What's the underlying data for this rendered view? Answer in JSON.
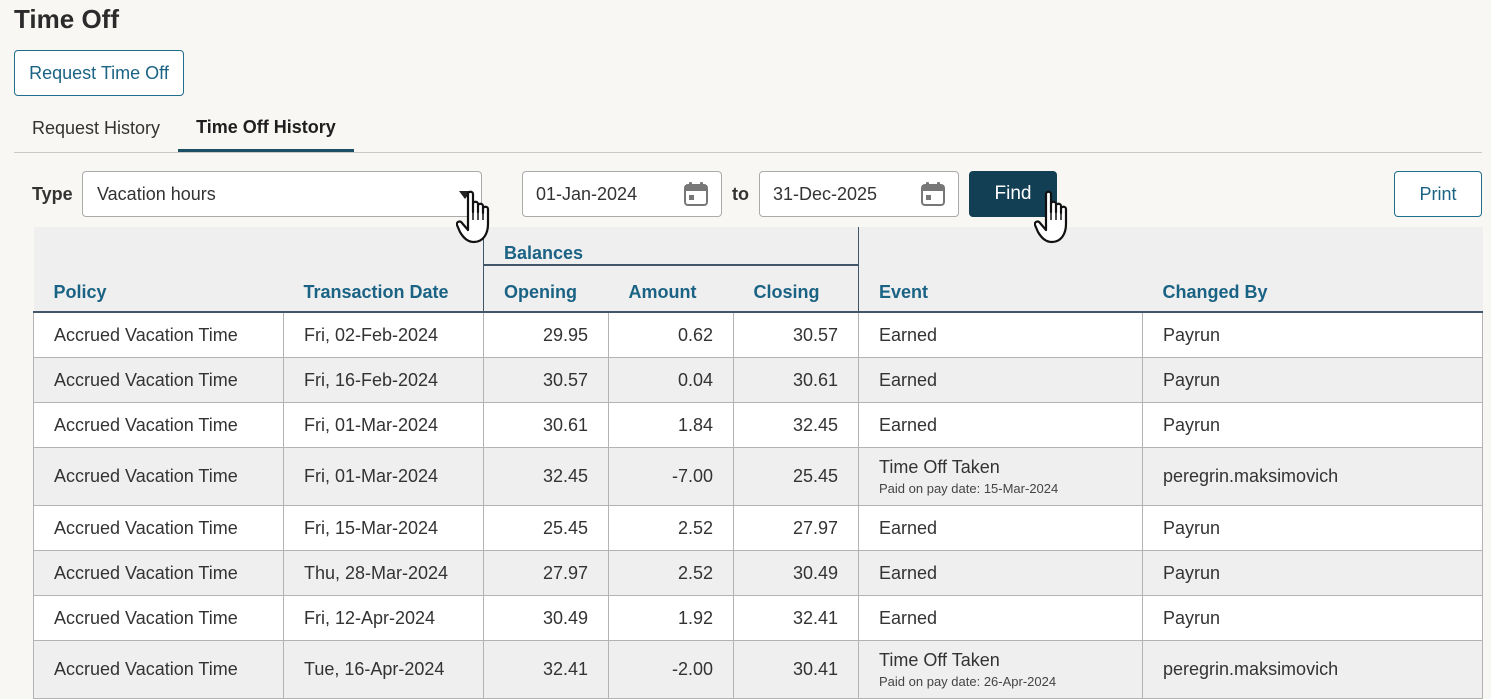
{
  "page": {
    "title": "Time Off"
  },
  "actions": {
    "request_label": "Request Time Off",
    "find_label": "Find",
    "print_label": "Print"
  },
  "tabs": [
    {
      "label": "Request History",
      "active": false
    },
    {
      "label": "Time Off History",
      "active": true
    }
  ],
  "filters": {
    "type_label": "Type",
    "type_value": "Vacation hours",
    "date_from": "01-Jan-2024",
    "to_label": "to",
    "date_to": "31-Dec-2025"
  },
  "table": {
    "group_header": "Balances",
    "columns": {
      "policy": "Policy",
      "transaction_date": "Transaction Date",
      "opening": "Opening",
      "amount": "Amount",
      "closing": "Closing",
      "event": "Event",
      "changed_by": "Changed By"
    },
    "rows": [
      {
        "policy": "Accrued Vacation Time",
        "date": "Fri, 02-Feb-2024",
        "opening": "29.95",
        "amount": "0.62",
        "closing": "30.57",
        "event": "Earned",
        "event_note": "",
        "changed_by": "Payrun"
      },
      {
        "policy": "Accrued Vacation Time",
        "date": "Fri, 16-Feb-2024",
        "opening": "30.57",
        "amount": "0.04",
        "closing": "30.61",
        "event": "Earned",
        "event_note": "",
        "changed_by": "Payrun"
      },
      {
        "policy": "Accrued Vacation Time",
        "date": "Fri, 01-Mar-2024",
        "opening": "30.61",
        "amount": "1.84",
        "closing": "32.45",
        "event": "Earned",
        "event_note": "",
        "changed_by": "Payrun"
      },
      {
        "policy": "Accrued Vacation Time",
        "date": "Fri, 01-Mar-2024",
        "opening": "32.45",
        "amount": "-7.00",
        "closing": "25.45",
        "event": "Time Off Taken",
        "event_note": "Paid on pay date: 15-Mar-2024",
        "changed_by": "peregrin.maksimovich"
      },
      {
        "policy": "Accrued Vacation Time",
        "date": "Fri, 15-Mar-2024",
        "opening": "25.45",
        "amount": "2.52",
        "closing": "27.97",
        "event": "Earned",
        "event_note": "",
        "changed_by": "Payrun"
      },
      {
        "policy": "Accrued Vacation Time",
        "date": "Thu, 28-Mar-2024",
        "opening": "27.97",
        "amount": "2.52",
        "closing": "30.49",
        "event": "Earned",
        "event_note": "",
        "changed_by": "Payrun"
      },
      {
        "policy": "Accrued Vacation Time",
        "date": "Fri, 12-Apr-2024",
        "opening": "30.49",
        "amount": "1.92",
        "closing": "32.41",
        "event": "Earned",
        "event_note": "",
        "changed_by": "Payrun"
      },
      {
        "policy": "Accrued Vacation Time",
        "date": "Tue, 16-Apr-2024",
        "opening": "32.41",
        "amount": "-2.00",
        "closing": "30.41",
        "event": "Time Off Taken",
        "event_note": "Paid on pay date: 26-Apr-2024",
        "changed_by": "peregrin.maksimovich"
      }
    ]
  },
  "icons": {
    "calendar": "calendar-icon",
    "caret": "caret-down-icon",
    "cursor": "pointer-hand-icon"
  },
  "colors": {
    "accent": "#1a6384",
    "find_button": "#133f55",
    "header_bg": "#efefef",
    "page_bg": "#f8f7f3"
  }
}
